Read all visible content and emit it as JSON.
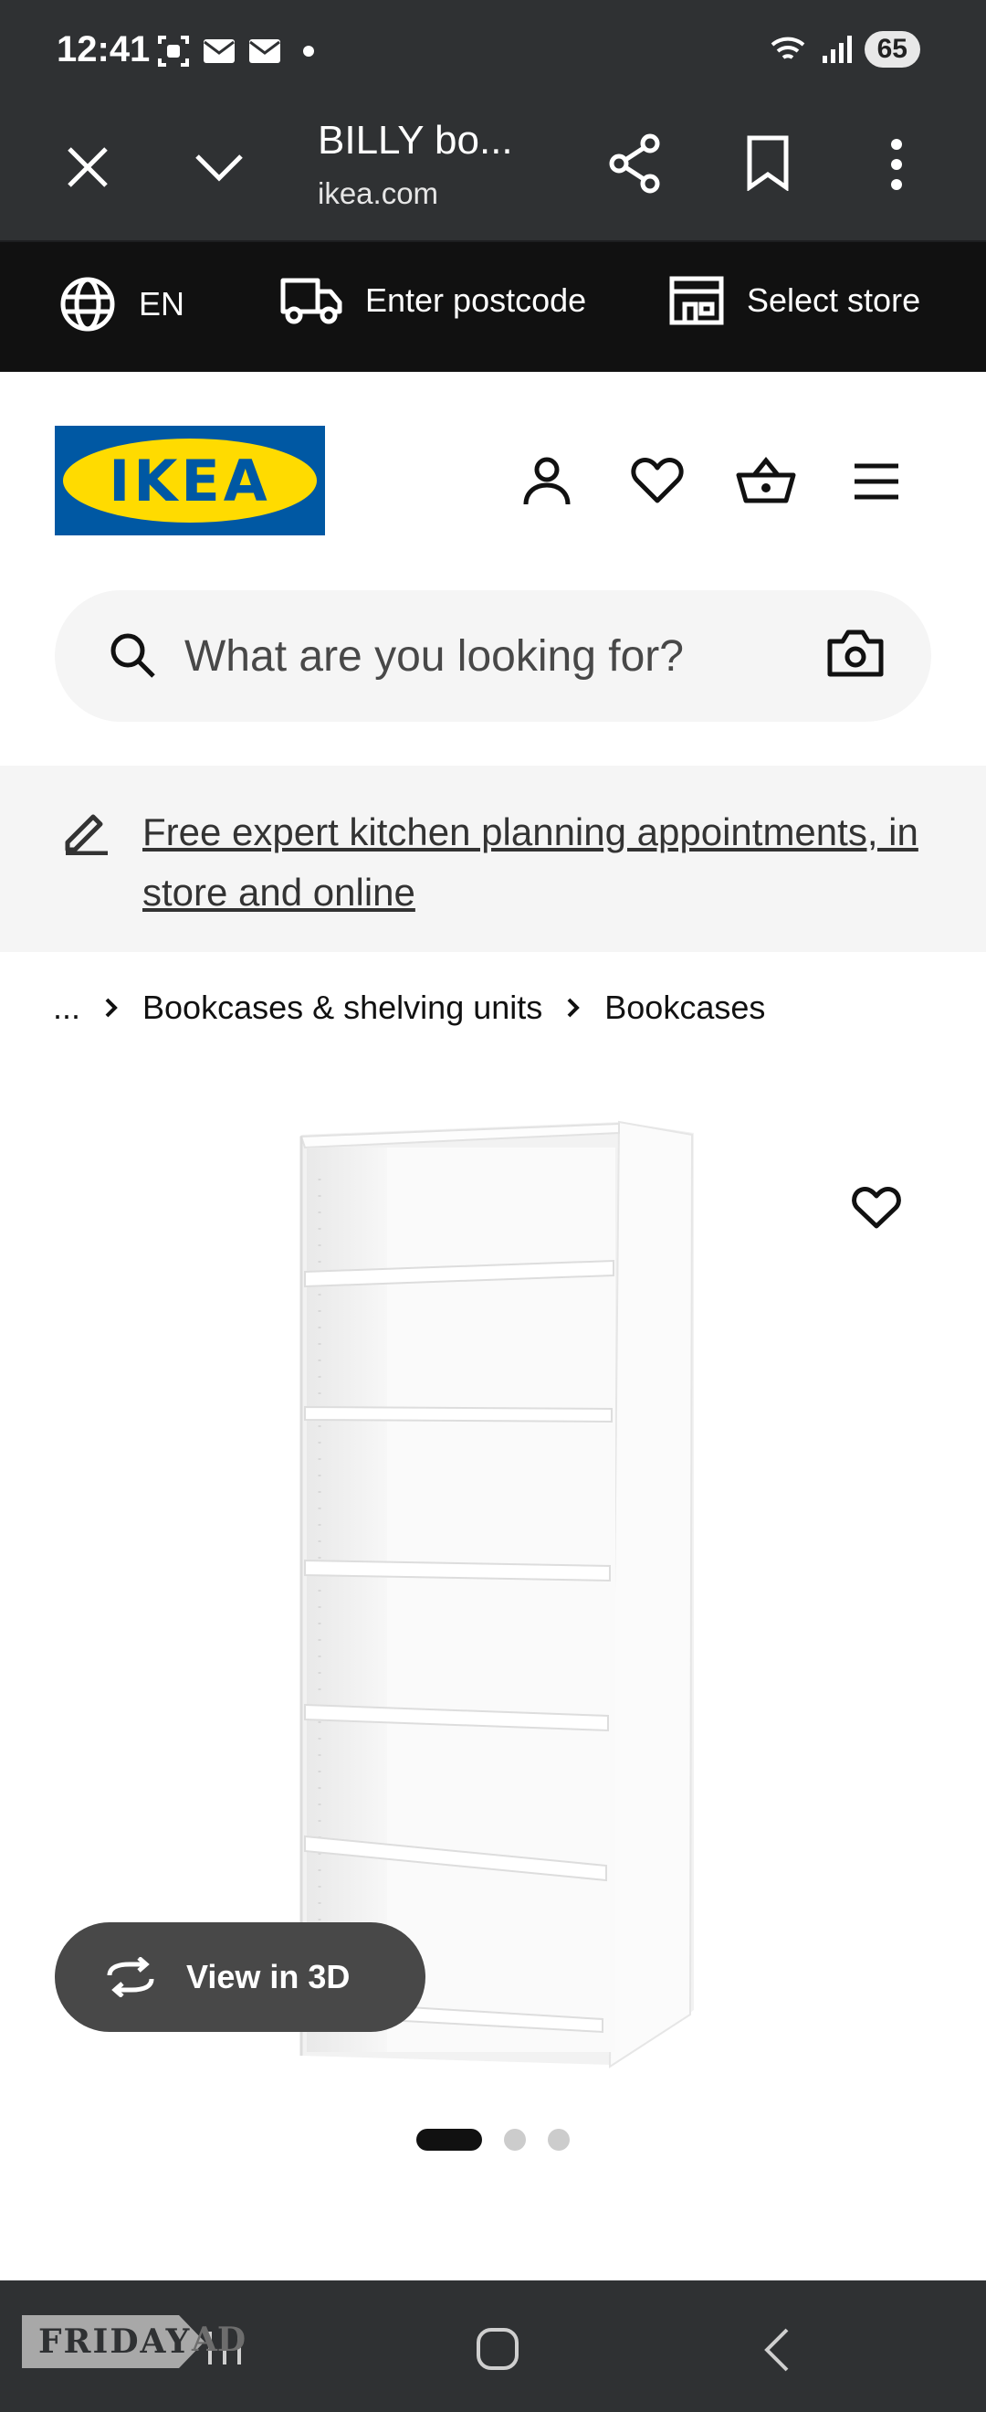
{
  "status": {
    "time": "12:41",
    "battery": "65"
  },
  "browser": {
    "title": "BILLY bo...",
    "url": "ikea.com"
  },
  "utility": {
    "language": "EN",
    "postcode": "Enter postcode",
    "store": "Select store"
  },
  "brand": {
    "logo_text": "IKEA",
    "logo_blue": "#0058a3",
    "logo_yellow": "#ffdb00"
  },
  "search": {
    "placeholder": "What are you looking for?"
  },
  "promo": {
    "text": "Free expert kitchen planning appointments, in store and online"
  },
  "breadcrumb": {
    "items": [
      "...",
      "Bookcases & shelving units",
      "Bookcases"
    ]
  },
  "product": {
    "view3d_label": "View in 3D"
  },
  "carousel": {
    "total": 3,
    "active": 1
  },
  "watermark": {
    "text": "FRIDAY",
    "suffix": "AD"
  }
}
